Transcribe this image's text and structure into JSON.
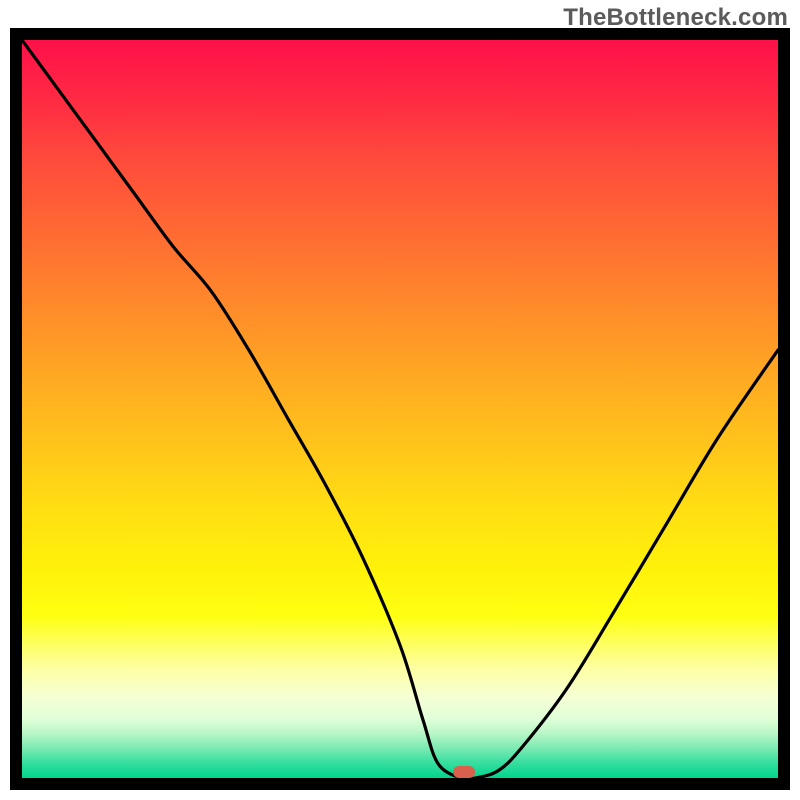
{
  "watermark": "TheBottleneck.com",
  "chart_data": {
    "type": "line",
    "title": "",
    "xlabel": "",
    "ylabel": "",
    "xlim": [
      0,
      100
    ],
    "ylim": [
      0,
      100
    ],
    "grid": false,
    "series": [
      {
        "name": "bottleneck-curve",
        "x": [
          0,
          5,
          10,
          15,
          20,
          25,
          30,
          35,
          40,
          45,
          50,
          53,
          55,
          58,
          60,
          63,
          66,
          72,
          78,
          85,
          92,
          100
        ],
        "y": [
          100,
          93,
          86,
          79,
          72,
          66,
          58,
          49,
          40,
          30,
          18,
          8,
          2,
          0,
          0,
          1,
          4,
          12,
          22,
          34,
          46,
          58
        ]
      }
    ],
    "marker": {
      "x": 58.5,
      "y": 0.8,
      "color": "#d9604c"
    },
    "gradient_stops": [
      {
        "pct": 0,
        "color": "#ff1049"
      },
      {
        "pct": 50,
        "color": "#ffc400"
      },
      {
        "pct": 80,
        "color": "#fff954"
      },
      {
        "pct": 100,
        "color": "#00d48c"
      }
    ]
  }
}
